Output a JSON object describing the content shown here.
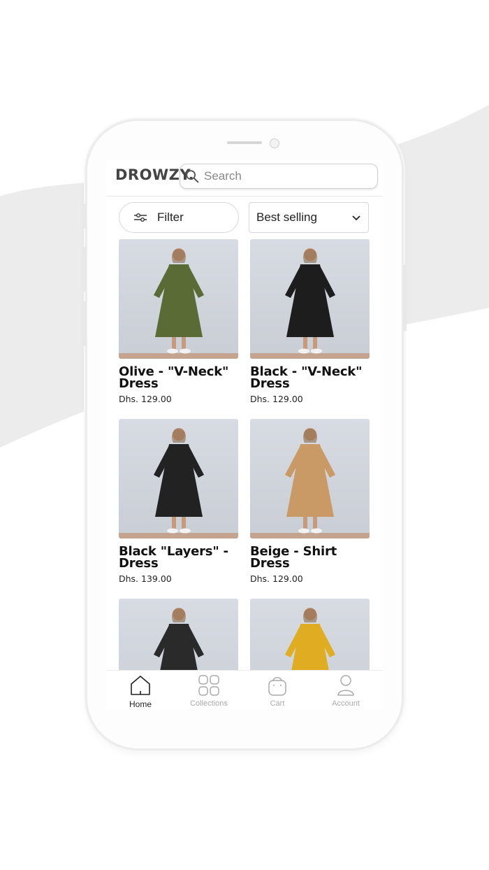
{
  "header": {
    "logo": "DROWZY.",
    "search_placeholder": "Search"
  },
  "toolbar": {
    "filter_label": "Filter",
    "sort_label": "Best selling"
  },
  "products": [
    {
      "title": "Olive - \"V-Neck\" Dress",
      "price": "Dhs. 129.00",
      "color": "#5a6b35"
    },
    {
      "title": "Black - \"V-Neck\" Dress",
      "price": "Dhs. 129.00",
      "color": "#1d1d1d"
    },
    {
      "title": "Black \"Layers\" - Dress",
      "price": "Dhs. 139.00",
      "color": "#222222"
    },
    {
      "title": "Beige - Shirt Dress",
      "price": "Dhs. 129.00",
      "color": "#c99a66"
    },
    {
      "title": "",
      "price": "",
      "color": "#2a2a2a"
    },
    {
      "title": "",
      "price": "",
      "color": "#e0ad22"
    }
  ],
  "tabs": [
    {
      "label": "Home",
      "icon": "home-icon"
    },
    {
      "label": "Collections",
      "icon": "grid-icon"
    },
    {
      "label": "Cart",
      "icon": "bag-icon"
    },
    {
      "label": "Account",
      "icon": "user-icon"
    }
  ]
}
